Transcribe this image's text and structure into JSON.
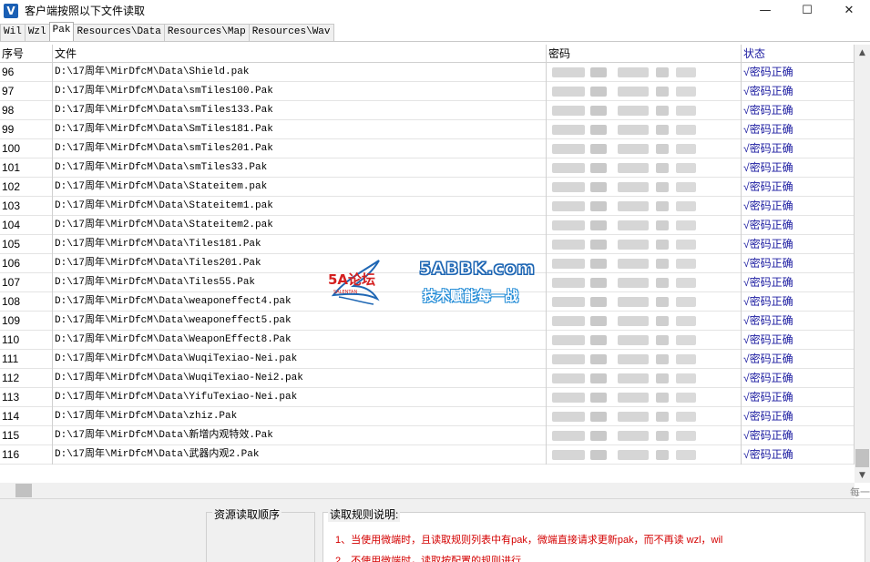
{
  "window": {
    "title": "客户端按照以下文件读取",
    "icon_letter": "V",
    "buttons": [
      "minimize-icon",
      "maximize-icon",
      "close-icon"
    ]
  },
  "tabs": [
    {
      "label": "Wil",
      "active": false
    },
    {
      "label": "Wzl",
      "active": false
    },
    {
      "label": "Pak",
      "active": true
    },
    {
      "label": "Resources\\Data",
      "active": false
    },
    {
      "label": "Resources\\Map",
      "active": false
    },
    {
      "label": "Resources\\Wav",
      "active": false
    }
  ],
  "grid": {
    "headers": {
      "no": "序号",
      "file": "文件",
      "password": "密码",
      "status": "状态"
    },
    "rows": [
      {
        "no": "96",
        "file": "D:\\17周年\\MirDfcM\\Data\\Shield.pak",
        "status": "√密码正确"
      },
      {
        "no": "97",
        "file": "D:\\17周年\\MirDfcM\\Data\\smTiles100.Pak",
        "status": "√密码正确"
      },
      {
        "no": "98",
        "file": "D:\\17周年\\MirDfcM\\Data\\smTiles133.Pak",
        "status": "√密码正确"
      },
      {
        "no": "99",
        "file": "D:\\17周年\\MirDfcM\\Data\\SmTiles181.Pak",
        "status": "√密码正确"
      },
      {
        "no": "100",
        "file": "D:\\17周年\\MirDfcM\\Data\\smTiles201.Pak",
        "status": "√密码正确"
      },
      {
        "no": "101",
        "file": "D:\\17周年\\MirDfcM\\Data\\smTiles33.Pak",
        "status": "√密码正确"
      },
      {
        "no": "102",
        "file": "D:\\17周年\\MirDfcM\\Data\\Stateitem.pak",
        "status": "√密码正确"
      },
      {
        "no": "103",
        "file": "D:\\17周年\\MirDfcM\\Data\\Stateitem1.pak",
        "status": "√密码正确"
      },
      {
        "no": "104",
        "file": "D:\\17周年\\MirDfcM\\Data\\Stateitem2.pak",
        "status": "√密码正确"
      },
      {
        "no": "105",
        "file": "D:\\17周年\\MirDfcM\\Data\\Tiles181.Pak",
        "status": "√密码正确"
      },
      {
        "no": "106",
        "file": "D:\\17周年\\MirDfcM\\Data\\Tiles201.Pak",
        "status": "√密码正确"
      },
      {
        "no": "107",
        "file": "D:\\17周年\\MirDfcM\\Data\\Tiles55.Pak",
        "status": "√密码正确"
      },
      {
        "no": "108",
        "file": "D:\\17周年\\MirDfcM\\Data\\weaponeffect4.pak",
        "status": "√密码正确"
      },
      {
        "no": "109",
        "file": "D:\\17周年\\MirDfcM\\Data\\weaponeffect5.pak",
        "status": "√密码正确"
      },
      {
        "no": "110",
        "file": "D:\\17周年\\MirDfcM\\Data\\WeaponEffect8.Pak",
        "status": "√密码正确"
      },
      {
        "no": "111",
        "file": "D:\\17周年\\MirDfcM\\Data\\WuqiTexiao-Nei.pak",
        "status": "√密码正确"
      },
      {
        "no": "112",
        "file": "D:\\17周年\\MirDfcM\\Data\\WuqiTexiao-Nei2.pak",
        "status": "√密码正确"
      },
      {
        "no": "113",
        "file": "D:\\17周年\\MirDfcM\\Data\\YifuTexiao-Nei.pak",
        "status": "√密码正确"
      },
      {
        "no": "114",
        "file": "D:\\17周年\\MirDfcM\\Data\\zhiz.Pak",
        "status": "√密码正确"
      },
      {
        "no": "115",
        "file": "D:\\17周年\\MirDfcM\\Data\\新增内观特效.Pak",
        "status": "√密码正确"
      },
      {
        "no": "116",
        "file": "D:\\17周年\\MirDfcM\\Data\\武器内观2.Pak",
        "status": "√密码正确"
      }
    ]
  },
  "scroll_hint": "每一",
  "bottom": {
    "order_title": "资源读取顺序",
    "rules_title": "读取规则说明:",
    "rules": [
      "1、当使用微端时，且读取规则列表中有pak，微端直接请求更新pak，而不再读 wzl，wil",
      "2、不使用微端时，读取按配置的规则进行"
    ]
  },
  "watermark": {
    "logo_text": "5A论坛",
    "logo_subtext": "SALENTAN",
    "site": "5ABBK.com",
    "slogan": "技术赋能每一战"
  },
  "colors": {
    "status_text": "#1a1aa0",
    "rule_text": "#d40000",
    "watermark_blue": "#1f67b4",
    "watermark_red": "#d42020"
  }
}
